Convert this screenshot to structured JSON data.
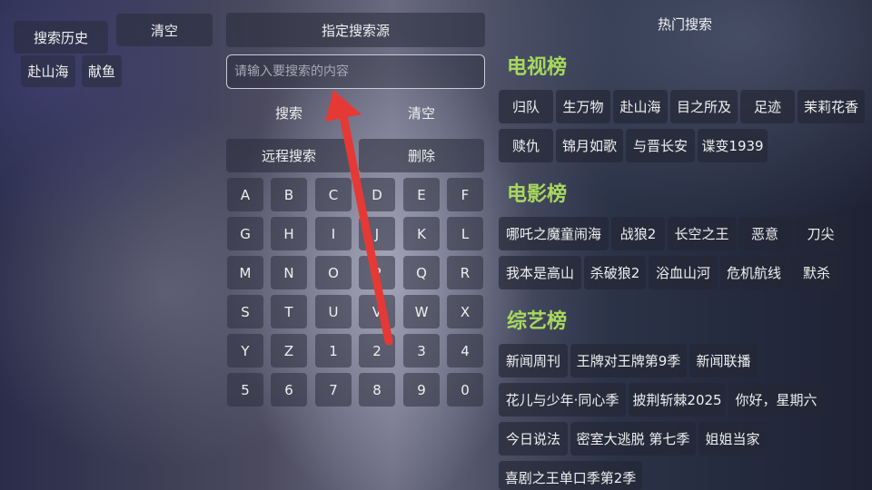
{
  "history": {
    "title": "搜索历史",
    "clear_label": "清空",
    "items": [
      "赴山海",
      "献鱼"
    ]
  },
  "search": {
    "source_label": "指定搜索源",
    "placeholder": "请输入要搜索的内容",
    "search_label": "搜索",
    "clear_label": "清空",
    "remote_label": "远程搜索",
    "delete_label": "删除"
  },
  "keyboard": {
    "rows": [
      [
        "A",
        "B",
        "C",
        "D",
        "E",
        "F"
      ],
      [
        "G",
        "H",
        "I",
        "J",
        "K",
        "L"
      ],
      [
        "M",
        "N",
        "O",
        "P",
        "Q",
        "R"
      ],
      [
        "S",
        "T",
        "U",
        "V",
        "W",
        "X"
      ],
      [
        "Y",
        "Z",
        "1",
        "2",
        "3",
        "4"
      ],
      [
        "5",
        "6",
        "7",
        "8",
        "9",
        "0"
      ]
    ]
  },
  "hot": {
    "title": "热门搜索",
    "tv": {
      "title": "电视榜",
      "items": [
        "归队",
        "生万物",
        "赴山海",
        "目之所及",
        "足迹",
        "茉莉花香",
        "赎仇",
        "锦月如歌",
        "与晋长安",
        "谍变1939"
      ]
    },
    "movie": {
      "title": "电影榜",
      "items": [
        "哪吒之魔童闹海",
        "战狼2",
        "长空之王",
        "恶意",
        "刀尖",
        "我本是高山",
        "杀破狼2",
        "浴血山河",
        "危机航线",
        "默杀"
      ]
    },
    "variety": {
      "title": "综艺榜",
      "items": [
        "新闻周刊",
        "王牌对王牌第9季",
        "新闻联播",
        "花儿与少年·同心季",
        "披荆斩棘2025",
        "你好，星期六",
        "今日说法",
        "密室大逃脱 第七季",
        "姐姐当家",
        "喜剧之王单口季第2季"
      ]
    }
  },
  "colors": {
    "section_title": "#a7d85e",
    "arrow": "#e53935"
  }
}
